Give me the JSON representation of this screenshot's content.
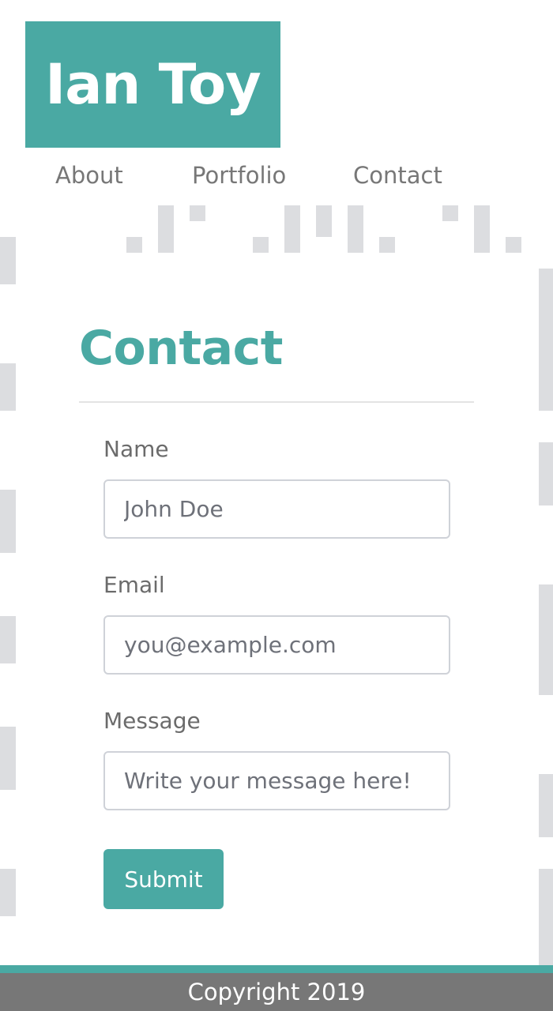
{
  "header": {
    "brand": "Ian Toy",
    "nav": [
      {
        "label": "About"
      },
      {
        "label": "Portfolio"
      },
      {
        "label": "Contact"
      }
    ]
  },
  "main": {
    "title": "Contact",
    "form": {
      "name_label": "Name",
      "name_placeholder": "John Doe",
      "email_label": "Email",
      "email_placeholder": "you@example.com",
      "message_label": "Message",
      "message_placeholder": "Write your message here!",
      "submit_label": "Submit"
    }
  },
  "footer": {
    "copyright": "Copyright 2019"
  },
  "colors": {
    "accent": "#4aa9a3",
    "footer_bg": "#777777",
    "pattern": "#dcdde0"
  }
}
